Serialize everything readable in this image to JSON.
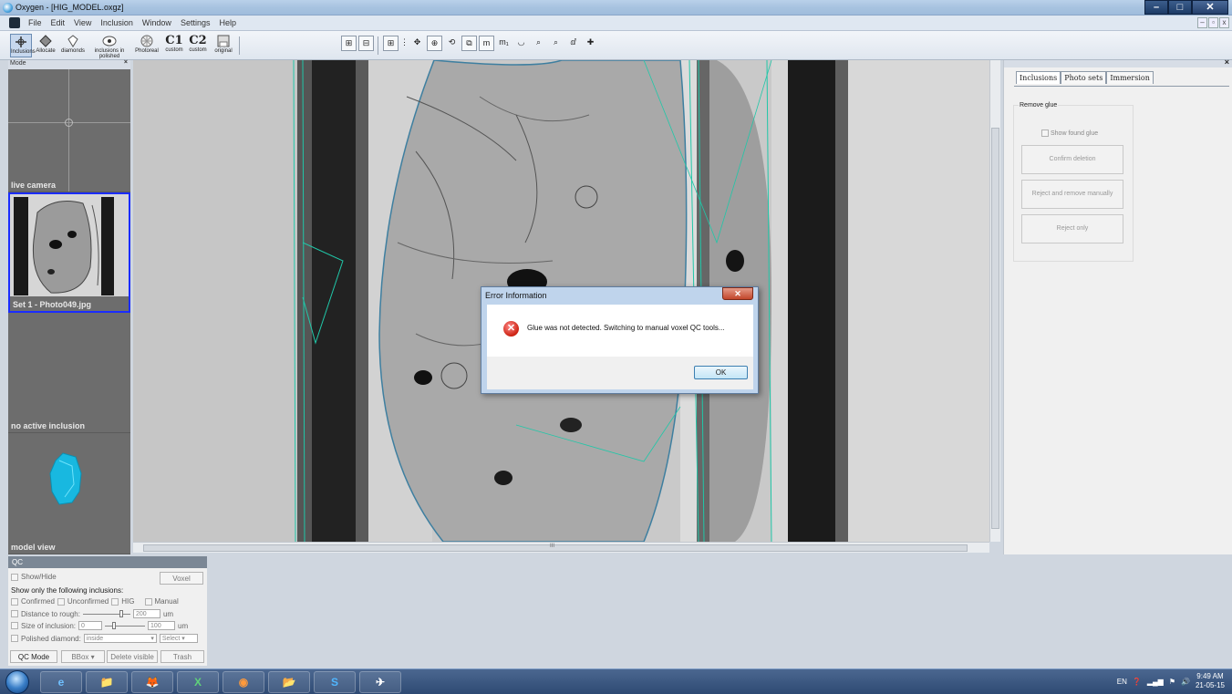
{
  "window": {
    "title": "Oxygen - [HIG_MODEL.oxgz]",
    "minimize": "–",
    "maximize": "□",
    "close": "✕"
  },
  "menu": {
    "items": [
      "File",
      "Edit",
      "View",
      "Inclusion",
      "Window",
      "Settings",
      "Help"
    ]
  },
  "toolbar": {
    "tools": [
      {
        "label": "Inclusions",
        "icon": "inclusions-icon"
      },
      {
        "label": "Allocate",
        "icon": "allocate-icon"
      },
      {
        "label": "diamonds",
        "icon": "diamond-icon"
      },
      {
        "label": "inclusions in polished",
        "icon": "polished-icon"
      },
      {
        "label": "Photoreal",
        "icon": "photoreal-icon"
      },
      {
        "label": "custom",
        "big": "C1"
      },
      {
        "label": "custom",
        "big": "C2"
      },
      {
        "label": "original",
        "icon": "save-icon"
      }
    ],
    "view_tools": [
      "⊞",
      "⋮",
      "✥",
      "⊕",
      "⟲",
      "⧉",
      "m",
      "m₁",
      "◡",
      "⌕",
      "⌕",
      "ⅆ",
      "✚"
    ]
  },
  "left_panel": {
    "header": "Mode",
    "thumbs": [
      {
        "caption": "live camera"
      },
      {
        "caption": "Set 1 - Photo049.jpg"
      },
      {
        "caption": "no active inclusion"
      },
      {
        "caption": "model view"
      }
    ]
  },
  "scroll": {
    "center_mark": "III"
  },
  "dialog": {
    "title": "Error Information",
    "close": "✕",
    "message": "Glue was not detected. Switching to manual voxel QC tools...",
    "ok": "OK"
  },
  "right_panel": {
    "tabs": [
      "Inclusions",
      "Photo sets",
      "Immersion"
    ],
    "group": "Remove glue",
    "checkbox": "Show found glue",
    "buttons": [
      "Confirm deletion",
      "Reject and remove manually",
      "Reject only"
    ]
  },
  "qc": {
    "header": "QC",
    "show_hide": "Show/Hide",
    "voxel": "Voxel",
    "only_label": "Show only the following inclusions:",
    "confirmed": "Confirmed",
    "unconfirmed": "Unconfirmed",
    "hig": "HIG",
    "manual": "Manual",
    "distance_label": "Distance to rough:",
    "distance_value": "200",
    "size_label": "Size of inclusion:",
    "size_min": "0",
    "size_max": "100",
    "unit": "um",
    "polished_label": "Polished diamond:",
    "polished_value": "inside",
    "select": "Select",
    "qc_mode": "QC Mode",
    "bbox": "BBox",
    "delete_visible": "Delete visible",
    "trash": "Trash"
  },
  "taskbar": {
    "apps": [
      "e",
      "📁",
      "🦊",
      "X",
      "◉",
      "📂",
      "S",
      "✈"
    ],
    "lang": "EN",
    "time": "9:49 AM",
    "date": "21-05-15"
  }
}
